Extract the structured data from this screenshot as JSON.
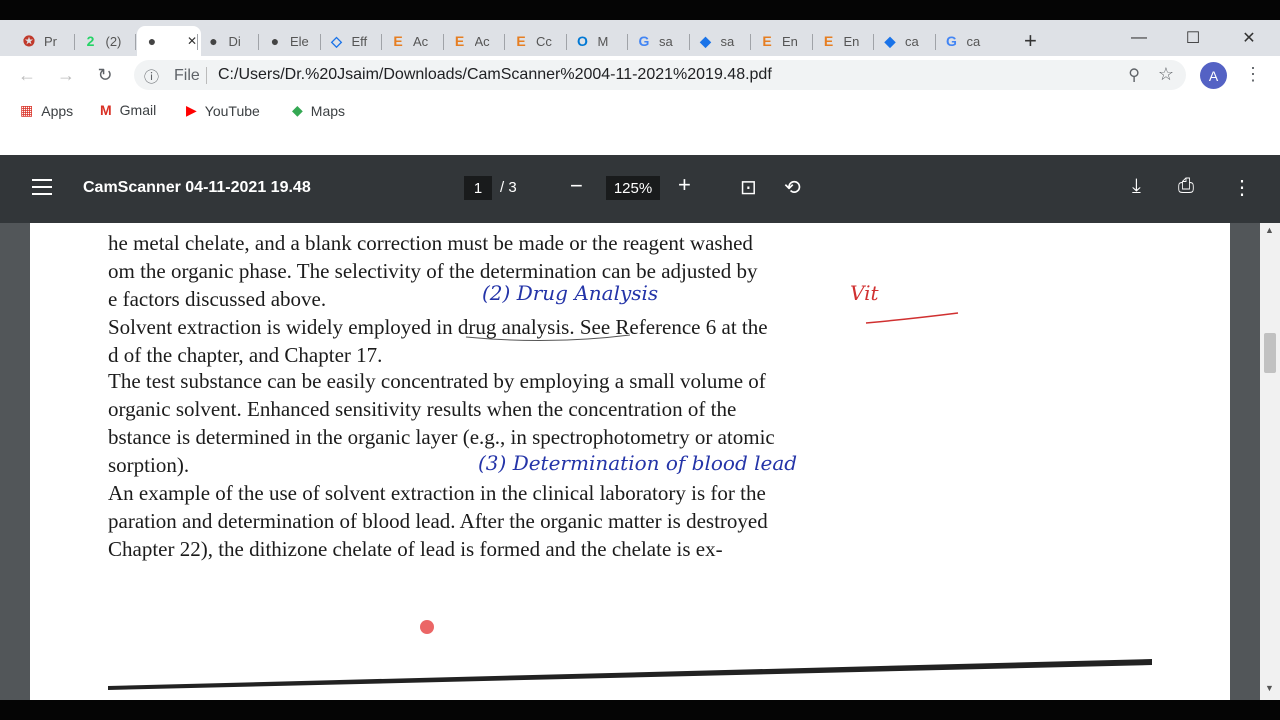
{
  "browser": {
    "tabs": [
      {
        "favicon": "figure-icon",
        "label": "Pr",
        "color": "#c0392b"
      },
      {
        "favicon": "whatsapp-icon",
        "label": "(2)",
        "color": "#25d366"
      },
      {
        "favicon": "globe-icon",
        "label": "",
        "color": "#444",
        "active": true
      },
      {
        "favicon": "globe-icon",
        "label": "Di",
        "color": "#444"
      },
      {
        "favicon": "globe-icon",
        "label": "Ele",
        "color": "#444"
      },
      {
        "favicon": "doc-icon",
        "label": "Eff",
        "color": "#1a73e8"
      },
      {
        "favicon": "e-icon",
        "label": "Ac",
        "color": "#e67e22"
      },
      {
        "favicon": "e-icon",
        "label": "Ac",
        "color": "#e67e22"
      },
      {
        "favicon": "e-icon",
        "label": "Cc",
        "color": "#e67e22"
      },
      {
        "favicon": "outlook-icon",
        "label": "M",
        "color": "#0078d4"
      },
      {
        "favicon": "google-icon",
        "label": "sa",
        "color": "#4285f4"
      },
      {
        "favicon": "diamond-icon",
        "label": "sa",
        "color": "#1a73e8"
      },
      {
        "favicon": "e-icon",
        "label": "En",
        "color": "#e67e22"
      },
      {
        "favicon": "e-icon",
        "label": "En",
        "color": "#e67e22"
      },
      {
        "favicon": "diamond-icon",
        "label": "ca",
        "color": "#1a73e8"
      },
      {
        "favicon": "google-icon",
        "label": "ca",
        "color": "#4285f4"
      }
    ],
    "new_tab": "+",
    "minimize": "—",
    "maximize": "☐",
    "close": "✕",
    "address": {
      "info_icon": "ⓘ",
      "scheme_label": "File",
      "url": "C:/Users/Dr.%20Jsaim/Downloads/CamScanner%2004-11-2021%2019.48.pdf"
    },
    "avatar_letter": "A",
    "bookmarks": [
      {
        "label": "Apps",
        "icon": "apps-grid-icon"
      },
      {
        "label": "Gmail",
        "icon": "gmail-icon"
      },
      {
        "label": "YouTube",
        "icon": "youtube-icon"
      },
      {
        "label": "Maps",
        "icon": "maps-icon"
      }
    ]
  },
  "pdf": {
    "title": "CamScanner 04-11-2021 19.48",
    "page_current": "1",
    "page_total": "/  3",
    "zoom": "125%",
    "minus": "−",
    "plus": "+",
    "lines": [
      "he metal chelate, and a blank correction must be made or the reagent washed",
      "om the organic phase. The selectivity of the determination can be adjusted by",
      "e factors discussed above.",
      "Solvent extraction is widely employed in drug analysis. See Reference 6 at the",
      "d of the chapter, and Chapter 17.",
      "The test substance can be easily concentrated by employing a small volume of",
      "organic solvent. Enhanced sensitivity results when the concentration of the",
      "bstance is determined in the organic layer (e.g., in spectrophotometry or atomic",
      "sorption).",
      "An example of the use of solvent extraction in the clinical laboratory is for the",
      "paration and determination of blood lead. After the organic matter is destroyed",
      "Chapter 22), the dithizone chelate of lead is formed and the chelate is ex-"
    ],
    "handwriting": {
      "note1": "(2)  Drug Analysis",
      "note2": "Vit",
      "note3": "(3)  Determination of blood lead"
    }
  }
}
